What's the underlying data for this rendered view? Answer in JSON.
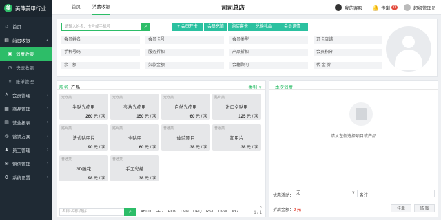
{
  "brand": {
    "logo_glyph": "美",
    "name": "美萍美甲行业"
  },
  "sidebar": {
    "items": [
      {
        "icon": "home-icon",
        "glyph": "⌂",
        "label": "首页"
      },
      {
        "icon": "cashier-icon",
        "glyph": "▤",
        "label": "前台收银",
        "expanded": true
      },
      {
        "icon": "consume-icon",
        "glyph": "▣",
        "label": "消费收银",
        "active": true
      },
      {
        "icon": "quick-consume-icon",
        "glyph": "◷",
        "label": "快速收银"
      },
      {
        "icon": "ledger-icon",
        "glyph": "≡",
        "label": "账单管理"
      },
      {
        "icon": "member-icon",
        "glyph": "♙",
        "label": "会员管理"
      },
      {
        "icon": "goods-icon",
        "glyph": "▦",
        "label": "商品管理"
      },
      {
        "icon": "report-icon",
        "glyph": "▥",
        "label": "营业报表"
      },
      {
        "icon": "marketing-icon",
        "glyph": "◎",
        "label": "营销方案"
      },
      {
        "icon": "staff-icon",
        "glyph": "♟",
        "label": "员工管理"
      },
      {
        "icon": "sms-icon",
        "glyph": "✉",
        "label": "短信管理"
      },
      {
        "icon": "settings-icon",
        "glyph": "⚙",
        "label": "系统设置"
      }
    ]
  },
  "topbar": {
    "tabs": [
      "首页",
      "消费收银"
    ],
    "store_title": "司司总店",
    "service_label": "我的客服",
    "notice_label": "传喇",
    "notice_count": "0",
    "user_label": "超级管理员"
  },
  "member": {
    "search_placeholder": "请输入姓名、卡号或手机号",
    "actions": [
      "+ 会员开卡",
      "会员充值",
      "购买套卡",
      "兑换礼品",
      "会员详情"
    ],
    "fields": [
      [
        "会员姓名",
        "会员卡号",
        "会员类型",
        "开卡店铺"
      ],
      [
        "手机号码",
        "服务折扣",
        "产品折扣",
        "会员积分"
      ],
      [
        "余　额",
        "欠款金额",
        "会籍顾问",
        "代 金 券"
      ]
    ]
  },
  "products": {
    "tabs": [
      "服务",
      "产品"
    ],
    "category_label": "类别 ∨",
    "items": [
      {
        "type": "光疗类",
        "name": "半贴光疗甲",
        "price": "260",
        "unit": "元 / 次"
      },
      {
        "type": "光疗类",
        "name": "亮片光疗甲",
        "price": "150",
        "unit": "元 / 次"
      },
      {
        "type": "光疗类",
        "name": "自然光疗甲",
        "price": "60",
        "unit": "元 / 次"
      },
      {
        "type": "贴片类",
        "name": "进口全贴甲",
        "price": "125",
        "unit": "元 / 次"
      },
      {
        "type": "贴片类",
        "name": "法式贴甲片",
        "price": "90",
        "unit": "元 / 次"
      },
      {
        "type": "贴片类",
        "name": "全贴甲",
        "price": "60",
        "unit": "元 / 次"
      },
      {
        "type": "普通类",
        "name": "体验项目",
        "price": "38",
        "unit": "元 / 次"
      },
      {
        "type": "普通类",
        "name": "卸甲片",
        "price": "38",
        "unit": "元 / 次"
      },
      {
        "type": "普通类",
        "name": "3D雕花",
        "price": "98",
        "unit": "元 / 次"
      },
      {
        "type": "普通类",
        "name": "手工彩绘",
        "price": "38",
        "unit": "元 / 次"
      }
    ],
    "search_placeholder": "名称/名称/简拼",
    "letters": [
      "ABCD",
      "EFG",
      "HIJK",
      "LMN",
      "OPQ",
      "RST",
      "UVW",
      "XYZ"
    ],
    "pager": {
      "prev": "‹",
      "page": "1 / 1"
    }
  },
  "consume": {
    "tab_label": "本次消费",
    "empty_text": "请从左侧选择项目或产品",
    "promo_label": "优惠活动：",
    "promo_value": "无",
    "note_label": "备注：",
    "total_label": "折后金额：",
    "total_value": "0 元",
    "hold_button": "挂单",
    "checkout_button": "结 账"
  },
  "colors": {
    "accent": "#2dbd68",
    "teal": "#2bc1a0",
    "sidebar": "#1f2a34",
    "badge": "#e34a3c"
  }
}
